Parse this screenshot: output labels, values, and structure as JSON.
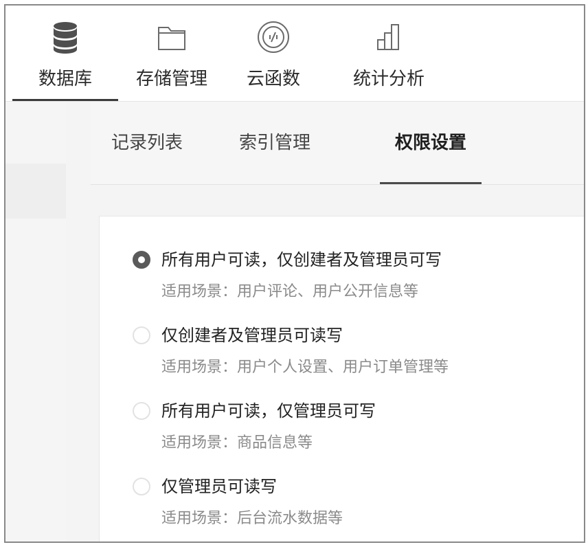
{
  "nav": {
    "items": [
      {
        "label": "数据库",
        "icon": "database-icon"
      },
      {
        "label": "存储管理",
        "icon": "folder-icon"
      },
      {
        "label": "云函数",
        "icon": "function-icon"
      },
      {
        "label": "统计分析",
        "icon": "bar-chart-icon"
      }
    ],
    "active_index": 0
  },
  "subtabs": {
    "items": [
      {
        "label": "记录列表"
      },
      {
        "label": "索引管理"
      },
      {
        "label": "权限设置"
      }
    ],
    "active_index": 2
  },
  "permissions": {
    "selected_index": 0,
    "options": [
      {
        "label": "所有用户可读，仅创建者及管理员可写",
        "desc": "适用场景：用户评论、用户公开信息等"
      },
      {
        "label": "仅创建者及管理员可读写",
        "desc": "适用场景：用户个人设置、用户订单管理等"
      },
      {
        "label": "所有用户可读，仅管理员可写",
        "desc": "适用场景：商品信息等"
      },
      {
        "label": "仅管理员可读写",
        "desc": "适用场景：后台流水数据等"
      }
    ]
  },
  "colors": {
    "text_primary": "#222222",
    "text_secondary": "#8a8a8a",
    "radio_checked": "#5a5a5a"
  }
}
